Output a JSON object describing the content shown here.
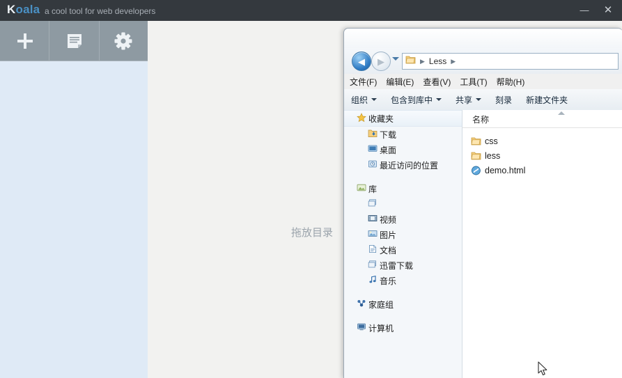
{
  "koala": {
    "title": "Koala",
    "title_first": "K",
    "title_rest": "oala",
    "tagline": "a cool tool for web developers",
    "window_controls": {
      "minimize": "—",
      "close": "✕",
      "minimize_icon": "minimize-icon",
      "close_icon": "close-icon"
    },
    "toolbar": [
      {
        "icon": "plus-icon",
        "label": "Add project"
      },
      {
        "icon": "log-document-icon",
        "label": "Log"
      },
      {
        "icon": "gear-icon",
        "label": "Settings"
      }
    ],
    "drop_hint": "拖放目录"
  },
  "explorer": {
    "nav": {
      "back_icon": "back-arrow-icon",
      "back_glyph": "◀",
      "forward_icon": "forward-arrow-icon",
      "forward_glyph": "▶",
      "history_dropdown_icon": "chevron-down-icon",
      "folder_icon": "folder-icon",
      "breadcrumb": [
        "Less"
      ],
      "crumb_separator": "▶"
    },
    "menubar": [
      "文件(F)",
      "编辑(E)",
      "查看(V)",
      "工具(T)",
      "帮助(H)"
    ],
    "toolbar": [
      {
        "label": "组织",
        "caret": true
      },
      {
        "label": "包含到库中",
        "caret": true
      },
      {
        "label": "共享",
        "caret": true
      },
      {
        "label": "刻录",
        "caret": false
      },
      {
        "label": "新建文件夹",
        "caret": false
      }
    ],
    "tree": [
      {
        "label": "收藏夹",
        "icon": "star-icon",
        "level": "root",
        "selected": true
      },
      {
        "label": "下载",
        "icon": "downloads-icon",
        "level": "child",
        "selected": false
      },
      {
        "label": "桌面",
        "icon": "desktop-icon",
        "level": "child",
        "selected": false
      },
      {
        "label": "最近访问的位置",
        "icon": "recent-places-icon",
        "level": "child",
        "selected": false
      },
      {
        "label": "",
        "icon": "gap",
        "level": "gap",
        "selected": false
      },
      {
        "label": "库",
        "icon": "library-icon",
        "level": "root",
        "selected": false
      },
      {
        "label": "",
        "icon": "library-item-icon",
        "level": "child",
        "selected": false
      },
      {
        "label": "视频",
        "icon": "video-icon",
        "level": "child",
        "selected": false
      },
      {
        "label": "图片",
        "icon": "pictures-icon",
        "level": "child",
        "selected": false
      },
      {
        "label": "文档",
        "icon": "documents-icon",
        "level": "child",
        "selected": false
      },
      {
        "label": "迅雷下载",
        "icon": "thunder-download-icon",
        "level": "child",
        "selected": false
      },
      {
        "label": "音乐",
        "icon": "music-icon",
        "level": "child",
        "selected": false
      },
      {
        "label": "",
        "icon": "gap",
        "level": "gap",
        "selected": false
      },
      {
        "label": "家庭组",
        "icon": "homegroup-icon",
        "level": "root",
        "selected": false
      },
      {
        "label": "",
        "icon": "gap",
        "level": "gap",
        "selected": false
      },
      {
        "label": "计算机",
        "icon": "computer-icon",
        "level": "root",
        "selected": false
      }
    ],
    "files": {
      "column_header": "名称",
      "sort_icon": "sort-ascending-icon",
      "items": [
        {
          "name": "css",
          "icon": "folder-icon"
        },
        {
          "name": "less",
          "icon": "folder-icon"
        },
        {
          "name": "demo.html",
          "icon": "html-file-icon"
        }
      ]
    }
  },
  "cursor": {
    "icon": "mouse-pointer-icon"
  },
  "colors": {
    "koala_titlebar": "#34393e",
    "koala_toolbar": "#8e9aa2",
    "koala_sidebar": "#dfeaf6",
    "koala_main": "#f2f2f0",
    "koala_logo_accent": "#4a90c4",
    "explorer_chrome": "#f0f0f0",
    "explorer_tree": "#f4f7fa"
  }
}
